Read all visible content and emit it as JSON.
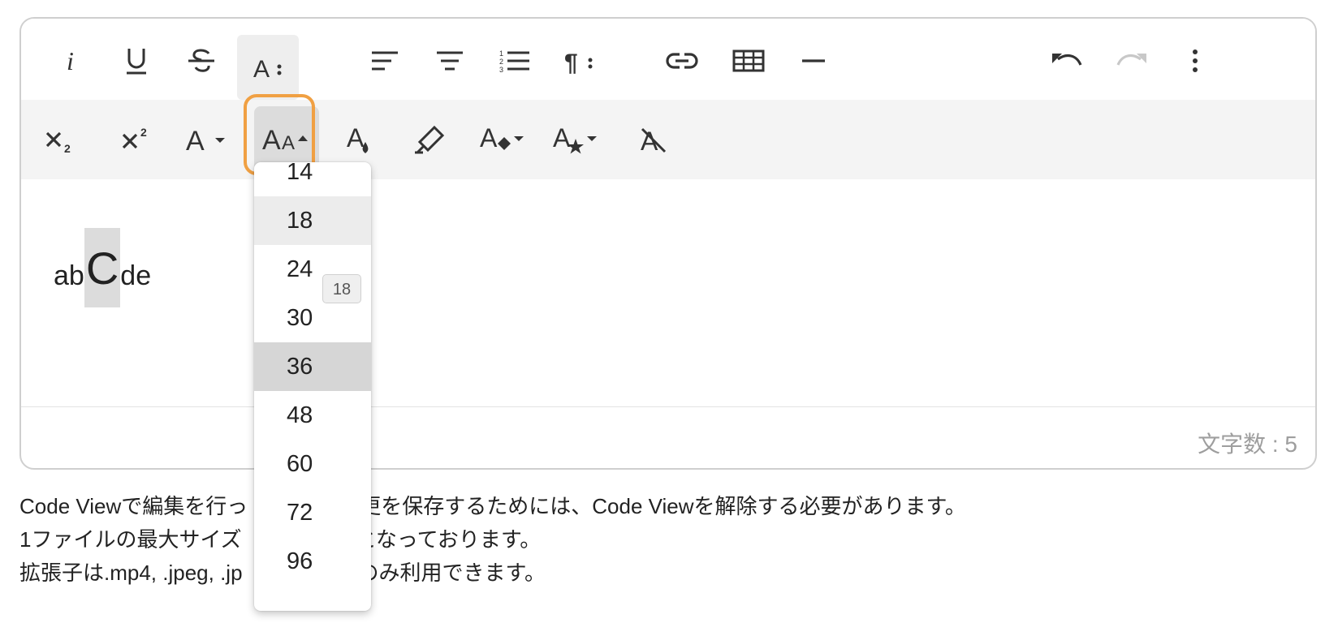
{
  "toolbar": {
    "row1": [
      {
        "name": "italic-button",
        "icon": "italic-icon"
      },
      {
        "name": "underline-button",
        "icon": "underline-icon"
      },
      {
        "name": "strikethrough-button",
        "icon": "strikethrough-icon"
      },
      {
        "name": "text-style-more-button",
        "icon": "text-style-more-icon",
        "active": true
      },
      {
        "name": "align-left-button",
        "icon": "align-left-icon"
      },
      {
        "name": "align-center-button",
        "icon": "align-center-icon"
      },
      {
        "name": "ordered-list-button",
        "icon": "ordered-list-icon"
      },
      {
        "name": "paragraph-more-button",
        "icon": "paragraph-more-icon"
      },
      {
        "name": "link-button",
        "icon": "link-icon"
      },
      {
        "name": "table-button",
        "icon": "table-icon"
      },
      {
        "name": "horizontal-rule-button",
        "icon": "horizontal-rule-icon"
      },
      {
        "name": "undo-button",
        "icon": "undo-icon"
      },
      {
        "name": "redo-button",
        "icon": "redo-icon",
        "disabled": true
      },
      {
        "name": "more-options-button",
        "icon": "more-vertical-icon"
      }
    ],
    "row2": [
      {
        "name": "subscript-button",
        "icon": "subscript-icon"
      },
      {
        "name": "superscript-button",
        "icon": "superscript-icon"
      },
      {
        "name": "font-family-button",
        "icon": "font-family-icon"
      },
      {
        "name": "font-size-button",
        "icon": "font-size-icon",
        "open": true
      },
      {
        "name": "text-color-button",
        "icon": "text-color-icon"
      },
      {
        "name": "background-color-button",
        "icon": "highlighter-icon"
      },
      {
        "name": "inline-class-button",
        "icon": "inline-class-icon"
      },
      {
        "name": "inline-style-button",
        "icon": "inline-style-icon"
      },
      {
        "name": "clear-formatting-button",
        "icon": "clear-formatting-icon"
      }
    ],
    "focus_color": "#f0a043"
  },
  "content": {
    "before": "ab",
    "selected": "C",
    "after": "de"
  },
  "status": {
    "char_count": "文字数 : 5"
  },
  "font_size_menu": {
    "options": [
      "14",
      "18",
      "24",
      "30",
      "36",
      "48",
      "60",
      "72",
      "96"
    ],
    "hovered": "18",
    "selected": "36",
    "tooltip": "18"
  },
  "notes": [
    "Code Viewで編集を行っ",
    "更を保存するためには、Code Viewを解除する必要があります。",
    "1ファイルの最大サイズ",
    "となっております。",
    "拡張子は.mp4, .jpeg, .jp",
    "のみ利用できます。"
  ]
}
